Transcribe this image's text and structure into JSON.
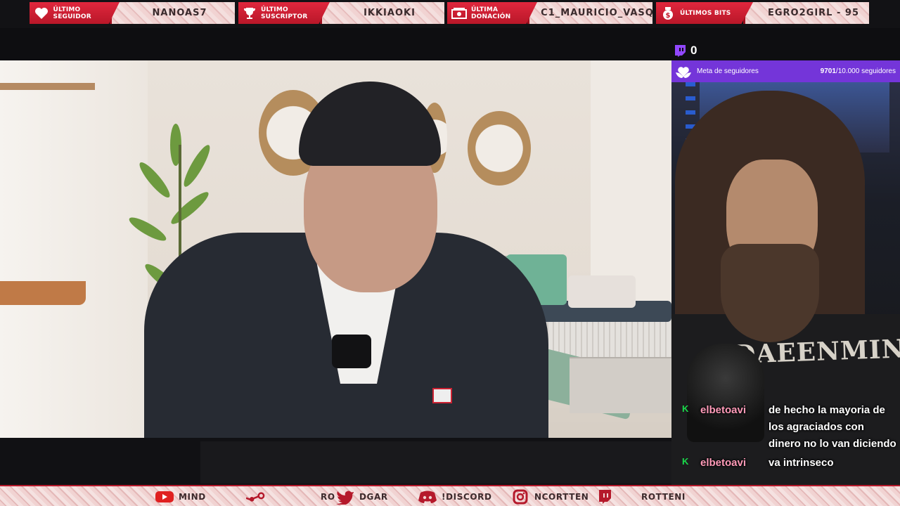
{
  "alerts": [
    {
      "label": "Último seguidor",
      "value": "NANOAS7",
      "icon": "heart-icon",
      "color": "#e0273d"
    },
    {
      "label": "Último suscriptor",
      "value": "IKKIAOKI",
      "icon": "trophy-icon",
      "color": "#e0273d"
    },
    {
      "label": "Última donación",
      "value": "C1_MAURICIO_VASQ",
      "icon": "money-icon",
      "color": "#e0273d"
    },
    {
      "label": "Últimos bits",
      "value": "EGRO2GIRL - 95",
      "icon": "bits-icon",
      "color": "#e0273d"
    }
  ],
  "streamer": {
    "viewer_count": "0",
    "goal": {
      "label": "Meta de seguidores",
      "current": "9701",
      "target": "/10.000 seguidores",
      "progress": 0.97
    },
    "shirt_print": "DAEENMIND"
  },
  "chat": [
    {
      "user": "elbetoavi",
      "message": "de hecho la mayoria de los agraciados con dinero no lo van diciendo",
      "badge": "K"
    },
    {
      "user": "elbetoavi",
      "message": "va intrinseco",
      "badge": "K"
    }
  ],
  "socials": [
    {
      "name": "youtube",
      "icon": "youtube-icon",
      "label": "MIND",
      "color": "#e02020"
    },
    {
      "name": "steam",
      "icon": "steam-icon",
      "label": "",
      "color": "#b5192b"
    },
    {
      "name": "twitter",
      "icon": "twitter-icon",
      "label": "RO",
      "color": "#b5192b"
    },
    {
      "name": "twitter-2",
      "icon": "twitter-icon",
      "label": "DGAR",
      "color": "#b5192b"
    },
    {
      "name": "discord",
      "icon": "discord-icon",
      "label": "!DISCORD",
      "color": "#b5192b"
    },
    {
      "name": "instagram",
      "icon": "instagram-icon",
      "label": "NCORTTEN",
      "color": "#b5192b"
    },
    {
      "name": "twitch",
      "icon": "twitch-icon",
      "label": "ROTTENI",
      "color": "#b5192b"
    }
  ],
  "colors": {
    "accent": "#e0273d",
    "goal_bar": "#7435d9",
    "chat_user": "#ff9bb9",
    "badge": "#19d94a"
  }
}
